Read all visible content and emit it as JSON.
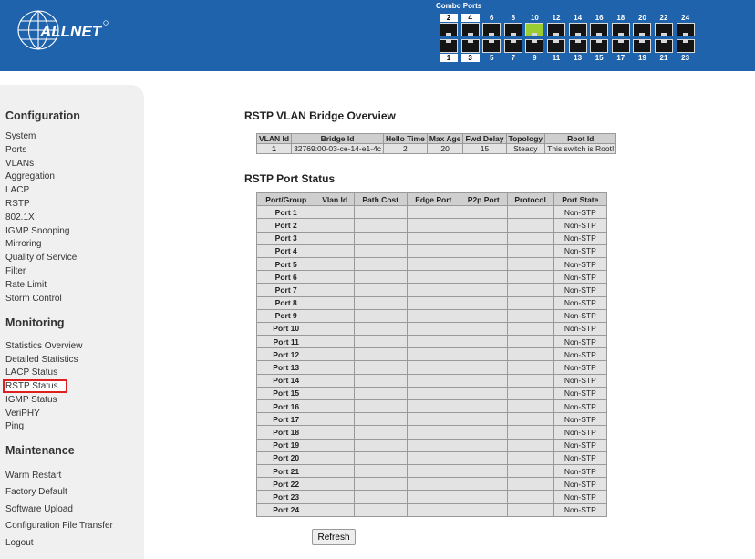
{
  "header": {
    "logo_text": "ALLNET",
    "combo_label": "Combo Ports",
    "ports_top": [
      {
        "num": "2",
        "boxed": true,
        "link": false
      },
      {
        "num": "4",
        "boxed": true,
        "link": false
      },
      {
        "num": "6",
        "boxed": false,
        "link": false
      },
      {
        "num": "8",
        "boxed": false,
        "link": false
      },
      {
        "num": "10",
        "boxed": false,
        "link": true
      },
      {
        "num": "12",
        "boxed": false,
        "link": false
      },
      {
        "num": "14",
        "boxed": false,
        "link": false
      },
      {
        "num": "16",
        "boxed": false,
        "link": false
      },
      {
        "num": "18",
        "boxed": false,
        "link": false
      },
      {
        "num": "20",
        "boxed": false,
        "link": false
      },
      {
        "num": "22",
        "boxed": false,
        "link": false
      },
      {
        "num": "24",
        "boxed": false,
        "link": false
      }
    ],
    "ports_bottom": [
      {
        "num": "1",
        "boxed": true,
        "link": false
      },
      {
        "num": "3",
        "boxed": true,
        "link": false
      },
      {
        "num": "5",
        "boxed": false,
        "link": false
      },
      {
        "num": "7",
        "boxed": false,
        "link": false
      },
      {
        "num": "9",
        "boxed": false,
        "link": false
      },
      {
        "num": "11",
        "boxed": false,
        "link": false
      },
      {
        "num": "13",
        "boxed": false,
        "link": false
      },
      {
        "num": "15",
        "boxed": false,
        "link": false
      },
      {
        "num": "17",
        "boxed": false,
        "link": false
      },
      {
        "num": "19",
        "boxed": false,
        "link": false
      },
      {
        "num": "21",
        "boxed": false,
        "link": false
      },
      {
        "num": "23",
        "boxed": false,
        "link": false
      }
    ]
  },
  "sidebar": {
    "configuration": {
      "title": "Configuration",
      "items": [
        "System",
        "Ports",
        "VLANs",
        "Aggregation",
        "LACP",
        "RSTP",
        "802.1X",
        "IGMP Snooping",
        "Mirroring",
        "Quality of Service",
        "Filter",
        "Rate Limit",
        "Storm Control"
      ]
    },
    "monitoring": {
      "title": "Monitoring",
      "items": [
        "Statistics Overview",
        "Detailed Statistics",
        "LACP Status",
        "RSTP Status",
        "IGMP Status",
        "VeriPHY",
        "Ping"
      ],
      "active": "RSTP Status"
    },
    "maintenance": {
      "title": "Maintenance",
      "items": [
        "Warm Restart",
        "Factory Default",
        "Software Upload",
        "Configuration File Transfer",
        "Logout"
      ]
    }
  },
  "main": {
    "bridge_title": "RSTP VLAN Bridge Overview",
    "bridge_headers": [
      "VLAN Id",
      "Bridge Id",
      "Hello Time",
      "Max Age",
      "Fwd Delay",
      "Topology",
      "Root Id"
    ],
    "bridge_row": [
      "1",
      "32769:00-03-ce-14-e1-4c",
      "2",
      "20",
      "15",
      "Steady",
      "This switch is Root!"
    ],
    "port_title": "RSTP Port Status",
    "port_headers": [
      "Port/Group",
      "Vlan Id",
      "Path Cost",
      "Edge Port",
      "P2p Port",
      "Protocol",
      "Port State"
    ],
    "port_rows": [
      [
        "Port 1",
        "",
        "",
        "",
        "",
        "",
        "Non-STP"
      ],
      [
        "Port 2",
        "",
        "",
        "",
        "",
        "",
        "Non-STP"
      ],
      [
        "Port 3",
        "",
        "",
        "",
        "",
        "",
        "Non-STP"
      ],
      [
        "Port 4",
        "",
        "",
        "",
        "",
        "",
        "Non-STP"
      ],
      [
        "Port 5",
        "",
        "",
        "",
        "",
        "",
        "Non-STP"
      ],
      [
        "Port 6",
        "",
        "",
        "",
        "",
        "",
        "Non-STP"
      ],
      [
        "Port 7",
        "",
        "",
        "",
        "",
        "",
        "Non-STP"
      ],
      [
        "Port 8",
        "",
        "",
        "",
        "",
        "",
        "Non-STP"
      ],
      [
        "Port 9",
        "",
        "",
        "",
        "",
        "",
        "Non-STP"
      ],
      [
        "Port 10",
        "",
        "",
        "",
        "",
        "",
        "Non-STP"
      ],
      [
        "Port 11",
        "",
        "",
        "",
        "",
        "",
        "Non-STP"
      ],
      [
        "Port 12",
        "",
        "",
        "",
        "",
        "",
        "Non-STP"
      ],
      [
        "Port 13",
        "",
        "",
        "",
        "",
        "",
        "Non-STP"
      ],
      [
        "Port 14",
        "",
        "",
        "",
        "",
        "",
        "Non-STP"
      ],
      [
        "Port 15",
        "",
        "",
        "",
        "",
        "",
        "Non-STP"
      ],
      [
        "Port 16",
        "",
        "",
        "",
        "",
        "",
        "Non-STP"
      ],
      [
        "Port 17",
        "",
        "",
        "",
        "",
        "",
        "Non-STP"
      ],
      [
        "Port 18",
        "",
        "",
        "",
        "",
        "",
        "Non-STP"
      ],
      [
        "Port 19",
        "",
        "",
        "",
        "",
        "",
        "Non-STP"
      ],
      [
        "Port 20",
        "",
        "",
        "",
        "",
        "",
        "Non-STP"
      ],
      [
        "Port 21",
        "",
        "",
        "",
        "",
        "",
        "Non-STP"
      ],
      [
        "Port 22",
        "",
        "",
        "",
        "",
        "",
        "Non-STP"
      ],
      [
        "Port 23",
        "",
        "",
        "",
        "",
        "",
        "Non-STP"
      ],
      [
        "Port 24",
        "",
        "",
        "",
        "",
        "",
        "Non-STP"
      ]
    ],
    "refresh_label": "Refresh"
  },
  "colors": {
    "header_bg": "#1f63ad",
    "sidebar_bg": "#f0f0f0",
    "active_outline": "#e02020",
    "link_port": "#9acd32"
  }
}
